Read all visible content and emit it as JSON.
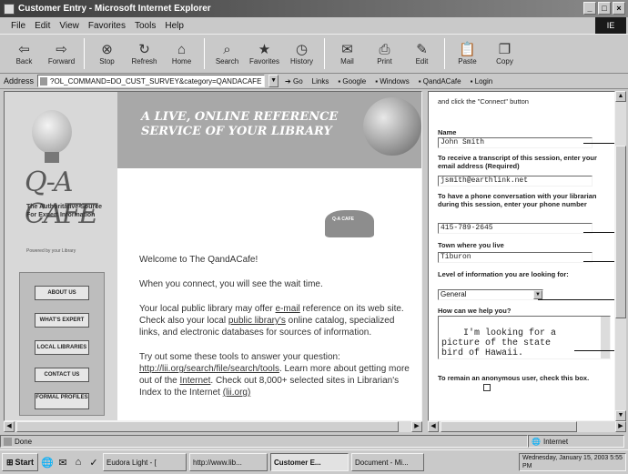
{
  "window": {
    "title": "Customer Entry - Microsoft Internet Explorer",
    "minimize": "_",
    "maximize": "□",
    "close": "×"
  },
  "menu": [
    "File",
    "Edit",
    "View",
    "Favorites",
    "Tools",
    "Help"
  ],
  "throbber": "IE",
  "toolbar": [
    {
      "label": "Back",
      "icon": "back-icon",
      "glyph": "⇦"
    },
    {
      "label": "Forward",
      "icon": "forward-icon",
      "glyph": "⇨"
    },
    {
      "label": "Stop",
      "icon": "stop-icon",
      "glyph": "⊗"
    },
    {
      "label": "Refresh",
      "icon": "refresh-icon",
      "glyph": "↻"
    },
    {
      "label": "Home",
      "icon": "home-icon",
      "glyph": "⌂"
    },
    {
      "label": "Search",
      "icon": "search-icon",
      "glyph": "⌕"
    },
    {
      "label": "Favorites",
      "icon": "favorites-icon",
      "glyph": "★"
    },
    {
      "label": "History",
      "icon": "history-icon",
      "glyph": "◷"
    },
    {
      "label": "Mail",
      "icon": "mail-icon",
      "glyph": "✉"
    },
    {
      "label": "Print",
      "icon": "print-icon",
      "glyph": "⎙"
    },
    {
      "label": "Edit",
      "icon": "edit-icon",
      "glyph": "✎"
    },
    {
      "label": "Paste",
      "icon": "paste-icon",
      "glyph": "📋"
    },
    {
      "label": "Copy",
      "icon": "copy-icon",
      "glyph": "❐"
    }
  ],
  "address": {
    "label": "Address",
    "value": "?OL_COMMAND=DO_CUST_SURVEY&category=QANDACAFE",
    "go": "Go",
    "links_label": "Links",
    "links": [
      "Google",
      "Windows",
      "QandACafe",
      "Login"
    ]
  },
  "left": {
    "logo": "Q-A CAFE",
    "tagline": "The Authoritative Source For Expert Information",
    "powered": "Powered by your Library",
    "banner": "A LIVE, ONLINE REFERENCE SERVICE OF YOUR LIBRARY",
    "book_label": "Q-A CAFE",
    "nav": [
      "ABOUT US",
      "WHAT'S EXPERT",
      "LOCAL LIBRARIES",
      "CONTACT US",
      "FORMAL PROFILES"
    ],
    "welcome": "Welcome to The QandACafe!",
    "wait": "When you connect, you will see the wait time.",
    "para1": {
      "a": "Your local public library may offer ",
      "link1": "e-mail",
      "b": " reference on its web site. Check also your local ",
      "link2": "public library's",
      "c": " online catalog, specialized links, and electronic databases for sources of information."
    },
    "para2": {
      "a": "Try out some these tools to answer your question: ",
      "link1": "http://lii.org/search/file/search/tools",
      "b": ". Learn more about getting more out of the ",
      "link2": "Internet",
      "c": ". Check out 8,000+ selected sites in Librarian's Index to the Internet ",
      "link3": "(lii.org)"
    }
  },
  "right": {
    "intro": "and click the \"Connect\" button",
    "name_label": "Name",
    "name_value": "John Smith",
    "email_label": "To receive a transcript of this session, enter your email address (Required)",
    "email_value": "jsmith@earthlink.net",
    "phone_label": "To have a phone conversation with your librarian during this session, enter your phone number",
    "phone_value": "415-789-2645",
    "town_label": "Town where you live",
    "town_value": "Tiburon",
    "level_label": "Level of information you are looking for:",
    "level_value": "General",
    "help_label": "How can we help you?",
    "help_value": "I'm looking for a\npicture of the state\nbird of Hawaii.",
    "anon_label": "To remain an anonymous user, check this box."
  },
  "status": {
    "left": "Done",
    "zone": "Internet"
  },
  "taskbar": {
    "start": "Start",
    "quick": [
      "🌐",
      "✉",
      "⌂",
      "✓"
    ],
    "tasks": [
      "Eudora Light - [",
      "http://www.lib...",
      "Customer E...",
      "Document - Mi..."
    ],
    "tray": "Wednesday, January 15, 2003   5:55 PM"
  }
}
